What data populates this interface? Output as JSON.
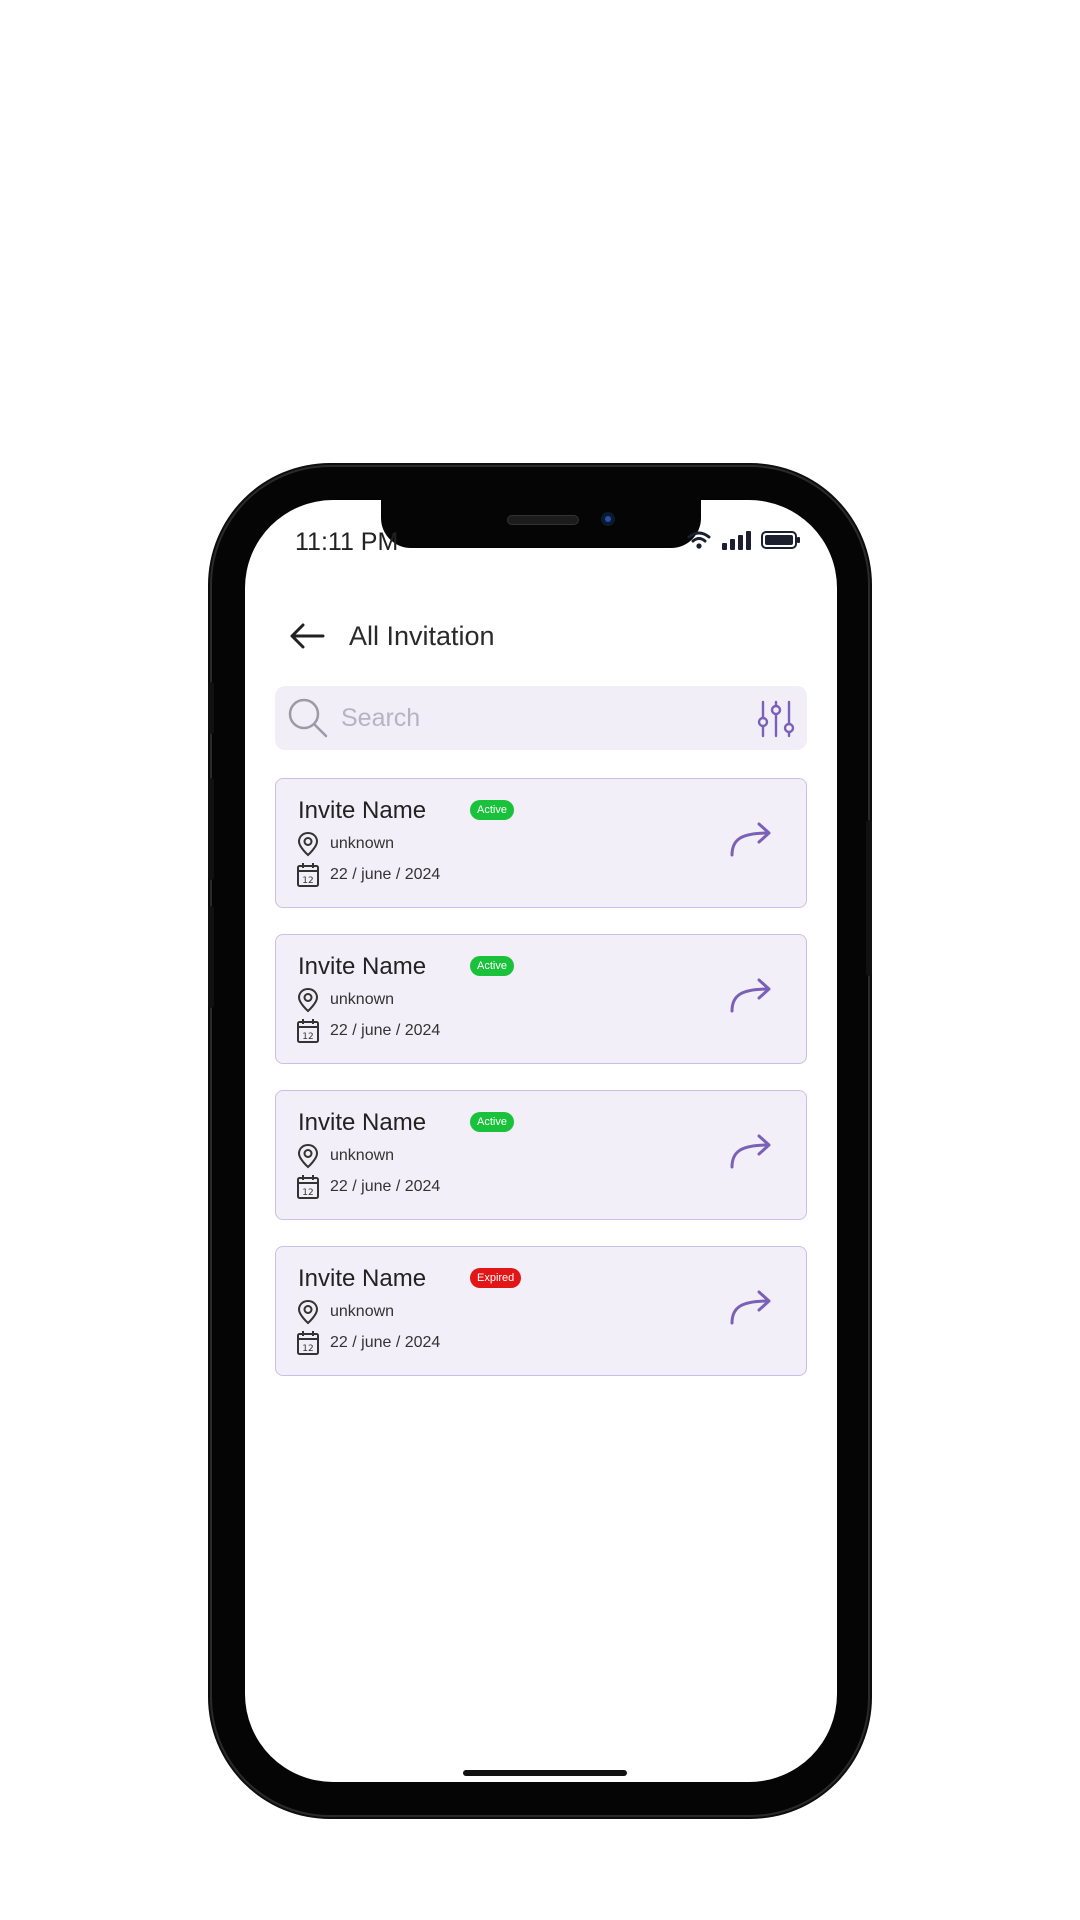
{
  "status_bar": {
    "time": "11:11 PM"
  },
  "header": {
    "title": "All Invitation"
  },
  "search": {
    "placeholder": "Search"
  },
  "colors": {
    "accent": "#7b60b8",
    "active": "#19c23a",
    "expired": "#e21616",
    "card_bg": "#f2eff8"
  },
  "invitations": [
    {
      "name": "Invite Name",
      "status": "Active",
      "location": "unknown",
      "date": "22 / june / 2024"
    },
    {
      "name": "Invite Name",
      "status": "Active",
      "location": "unknown",
      "date": "22 / june / 2024"
    },
    {
      "name": "Invite Name",
      "status": "Active",
      "location": "unknown",
      "date": "22 / june / 2024"
    },
    {
      "name": "Invite Name",
      "status": "Expired",
      "location": "unknown",
      "date": "22 / june / 2024"
    }
  ],
  "icons": {
    "back": "arrow-left-icon",
    "search": "search-icon",
    "filter": "sliders-icon",
    "location": "map-pin-icon",
    "calendar": "calendar-icon",
    "share": "share-arrow-icon"
  }
}
